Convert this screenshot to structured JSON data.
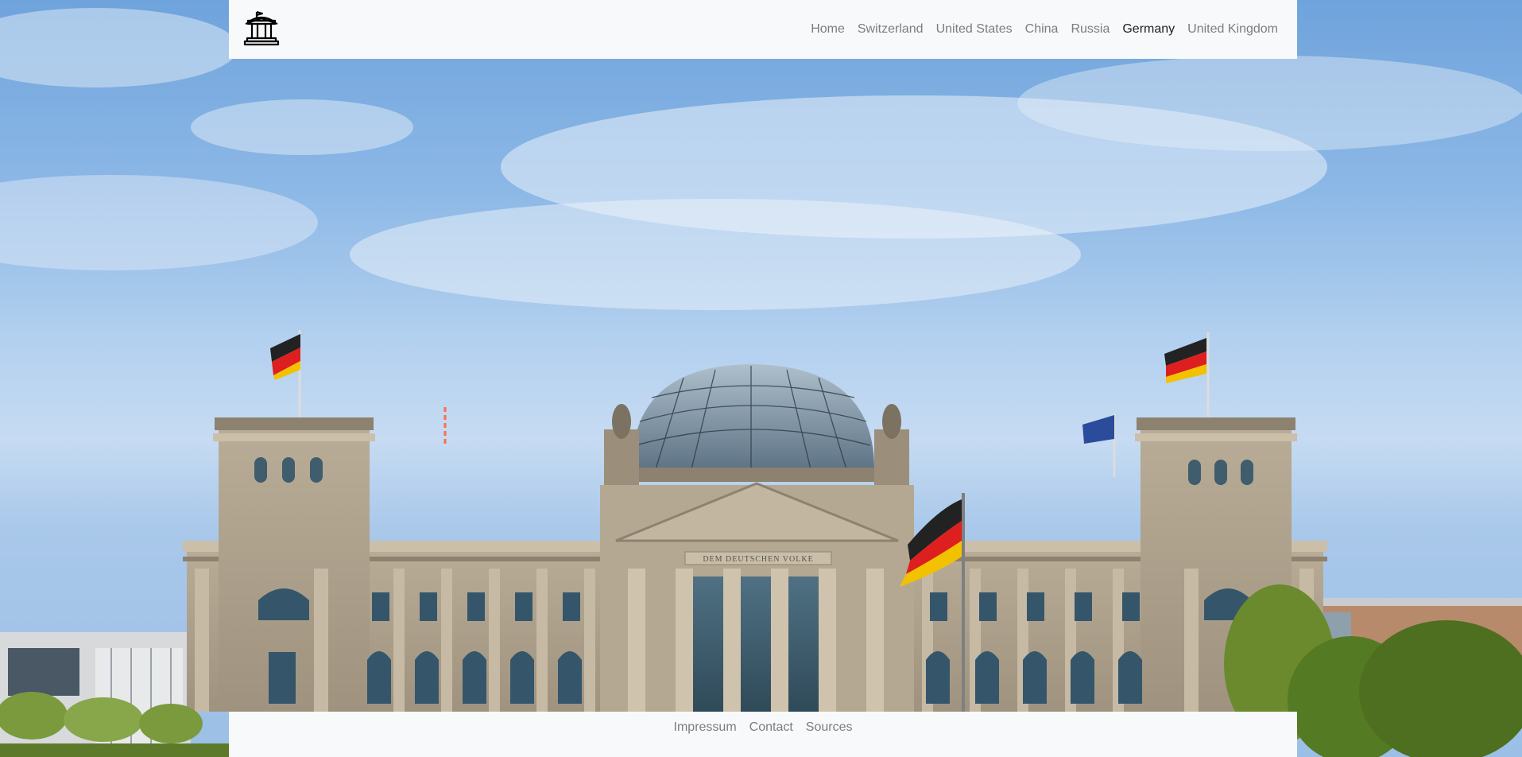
{
  "navbar": {
    "brand_icon": "government-building-icon",
    "links": [
      {
        "label": "Home",
        "active": false
      },
      {
        "label": "Switzerland",
        "active": false
      },
      {
        "label": "United States",
        "active": false
      },
      {
        "label": "China",
        "active": false
      },
      {
        "label": "Russia",
        "active": false
      },
      {
        "label": "Germany",
        "active": true
      },
      {
        "label": "United Kingdom",
        "active": false
      }
    ]
  },
  "hero": {
    "image_subject": "reichstag-building-photo",
    "inscription": "DEM DEUTSCHEN VOLKE"
  },
  "footer": {
    "links": [
      {
        "label": "Impressum"
      },
      {
        "label": "Contact"
      },
      {
        "label": "Sources"
      }
    ]
  },
  "colors": {
    "nav_background": "#f8f9fa",
    "nav_link": "#7d7d7d",
    "nav_link_active": "#1f1f1f"
  }
}
